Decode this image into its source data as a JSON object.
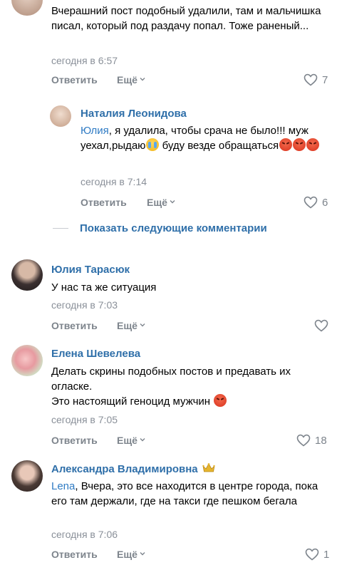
{
  "comments": [
    {
      "text": "Вчерашний пост подобный удалили, там и мальчишка писал, который под раздачу попал. Тоже раненый...",
      "time": "сегодня в 6:57",
      "reply": "Ответить",
      "more": "Ещё",
      "likes": "7"
    },
    {
      "author": "Наталия Леонидова",
      "mention": "Юлия",
      "text_a": ", я удалила, чтобы срача не было!!! муж уехал,рыдаю",
      "text_b": " буду везде обращаться",
      "time": "сегодня в 7:14",
      "reply": "Ответить",
      "more": "Ещё",
      "likes": "6"
    },
    {
      "author": "Юлия Тарасюк",
      "text": "У нас та же ситуация",
      "time": "сегодня в 7:03",
      "reply": "Ответить",
      "more": "Ещё"
    },
    {
      "author": "Елена Шевелева",
      "text_a": "Делать скрины подобных постов и предавать их огласке.",
      "text_b": "Это настоящий геноцид мужчин",
      "time": "сегодня в 7:05",
      "reply": "Ответить",
      "more": "Ещё",
      "likes": "18"
    },
    {
      "author": "Александра Владимировна",
      "mention": "Lena",
      "text": ", Вчера, это все находится в центре города, пока его там держали, где на такси где пешком бегала",
      "time": "сегодня в 7:06",
      "reply": "Ответить",
      "more": "Ещё",
      "likes": "1"
    }
  ],
  "show_more_label": "Показать следующие комментарии",
  "icons": {
    "heart": "heart-icon",
    "chevron": "chevron-down-icon",
    "angry": "angry-face-emoji",
    "cry": "crying-face-emoji",
    "crown": "crown-icon"
  },
  "colors": {
    "author": "#2f6fa9",
    "mention": "#2f7bc4",
    "meta": "#8a9099"
  }
}
